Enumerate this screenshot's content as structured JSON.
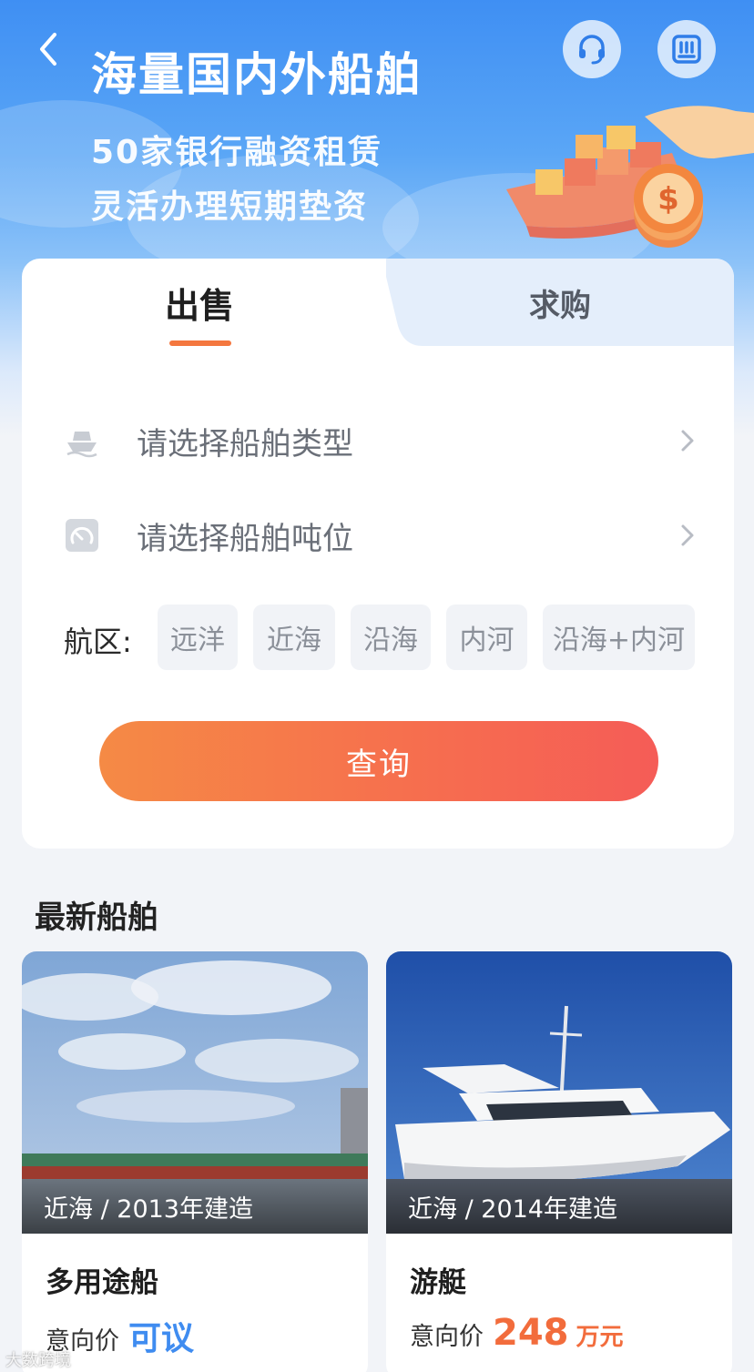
{
  "header": {
    "title": "海量国内外船舶",
    "subtitle_line1": "50家银行融资租赁",
    "subtitle_line2": "灵活办理短期垫资",
    "back_icon": "chevron-left-icon",
    "support_icon": "headset-icon",
    "scan_icon": "scan-icon"
  },
  "tabs": [
    {
      "label": "出售",
      "active": true
    },
    {
      "label": "求购",
      "active": false
    }
  ],
  "form": {
    "ship_type_placeholder": "请选择船舶类型",
    "tonnage_placeholder": "请选择船舶吨位",
    "area_label": "航区:",
    "areas": [
      "远洋",
      "近海",
      "沿海",
      "内河",
      "沿海+内河"
    ],
    "query_button": "查询"
  },
  "latest": {
    "title": "最新船舶",
    "ships": [
      {
        "caption": "近海 / 2013年建造",
        "name": "多用途船",
        "price_label": "意向价",
        "price_text": "可议"
      },
      {
        "caption": "近海 / 2014年建造",
        "name": "游艇",
        "price_label": "意向价",
        "price_value": "248",
        "price_unit": "万元"
      }
    ]
  },
  "watermark": "大数跨境",
  "colors": {
    "accent_orange": "#f4773f",
    "accent_blue": "#3f8cf0",
    "banner_blue": "#3f8ff3"
  }
}
